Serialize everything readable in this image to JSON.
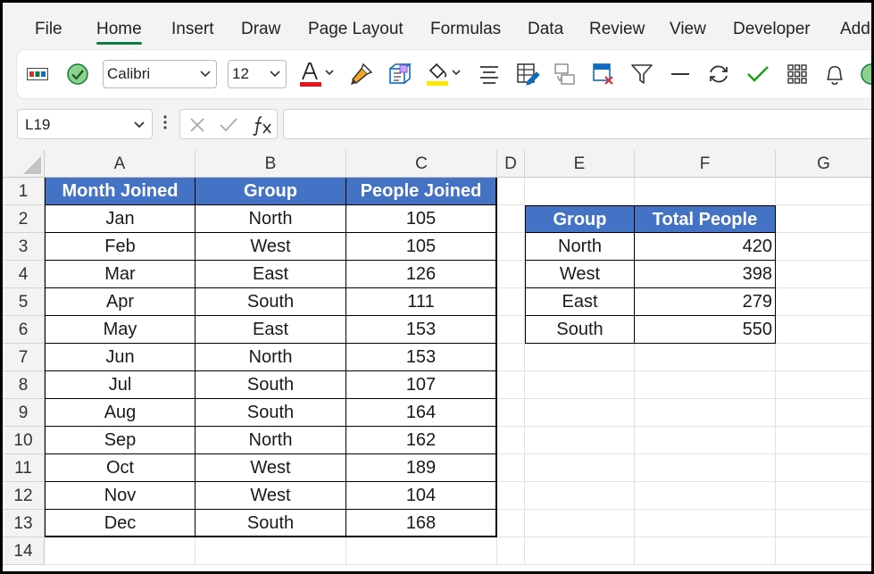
{
  "menu": [
    "File",
    "Home",
    "Insert",
    "Draw",
    "Page Layout",
    "Formulas",
    "Data",
    "Review",
    "View",
    "Developer",
    "Add"
  ],
  "active_menu": "Home",
  "ribbon": {
    "font_name": "Calibri",
    "font_size": "12",
    "font_color": "#e8141b",
    "fill_color": "#ffe600",
    "tools": [
      "status-bar-icon",
      "checkmark-circle-icon",
      "font-color-icon",
      "format-painter-icon",
      "cube-icon",
      "fill-color-icon",
      "align-icon",
      "format-icon",
      "copy-format-icon",
      "clear-format-icon",
      "filter-icon",
      "minus-icon",
      "refresh-icon",
      "check-icon",
      "grid-icon",
      "bell-icon"
    ]
  },
  "formula_bar": {
    "name_box": "L19",
    "formula": ""
  },
  "sheet": {
    "columns": [
      "A",
      "B",
      "C",
      "D",
      "E",
      "F",
      "G"
    ],
    "rows": [
      "1",
      "2",
      "3",
      "4",
      "5",
      "6",
      "7",
      "8",
      "9",
      "10",
      "11",
      "12",
      "13",
      "14"
    ],
    "table1": {
      "headers": [
        "Month Joined",
        "Group",
        "People Joined"
      ],
      "rows": [
        [
          "Jan",
          "North",
          "105"
        ],
        [
          "Feb",
          "West",
          "105"
        ],
        [
          "Mar",
          "East",
          "126"
        ],
        [
          "Apr",
          "South",
          "111"
        ],
        [
          "May",
          "East",
          "153"
        ],
        [
          "Jun",
          "North",
          "153"
        ],
        [
          "Jul",
          "South",
          "107"
        ],
        [
          "Aug",
          "South",
          "164"
        ],
        [
          "Sep",
          "North",
          "162"
        ],
        [
          "Oct",
          "West",
          "189"
        ],
        [
          "Nov",
          "West",
          "104"
        ],
        [
          "Dec",
          "South",
          "168"
        ]
      ]
    },
    "table2": {
      "headers": [
        "Group",
        "Total People"
      ],
      "rows": [
        [
          "North",
          "420"
        ],
        [
          "West",
          "398"
        ],
        [
          "East",
          "279"
        ],
        [
          "South",
          "550"
        ]
      ]
    },
    "header_color": "#4472c4"
  }
}
